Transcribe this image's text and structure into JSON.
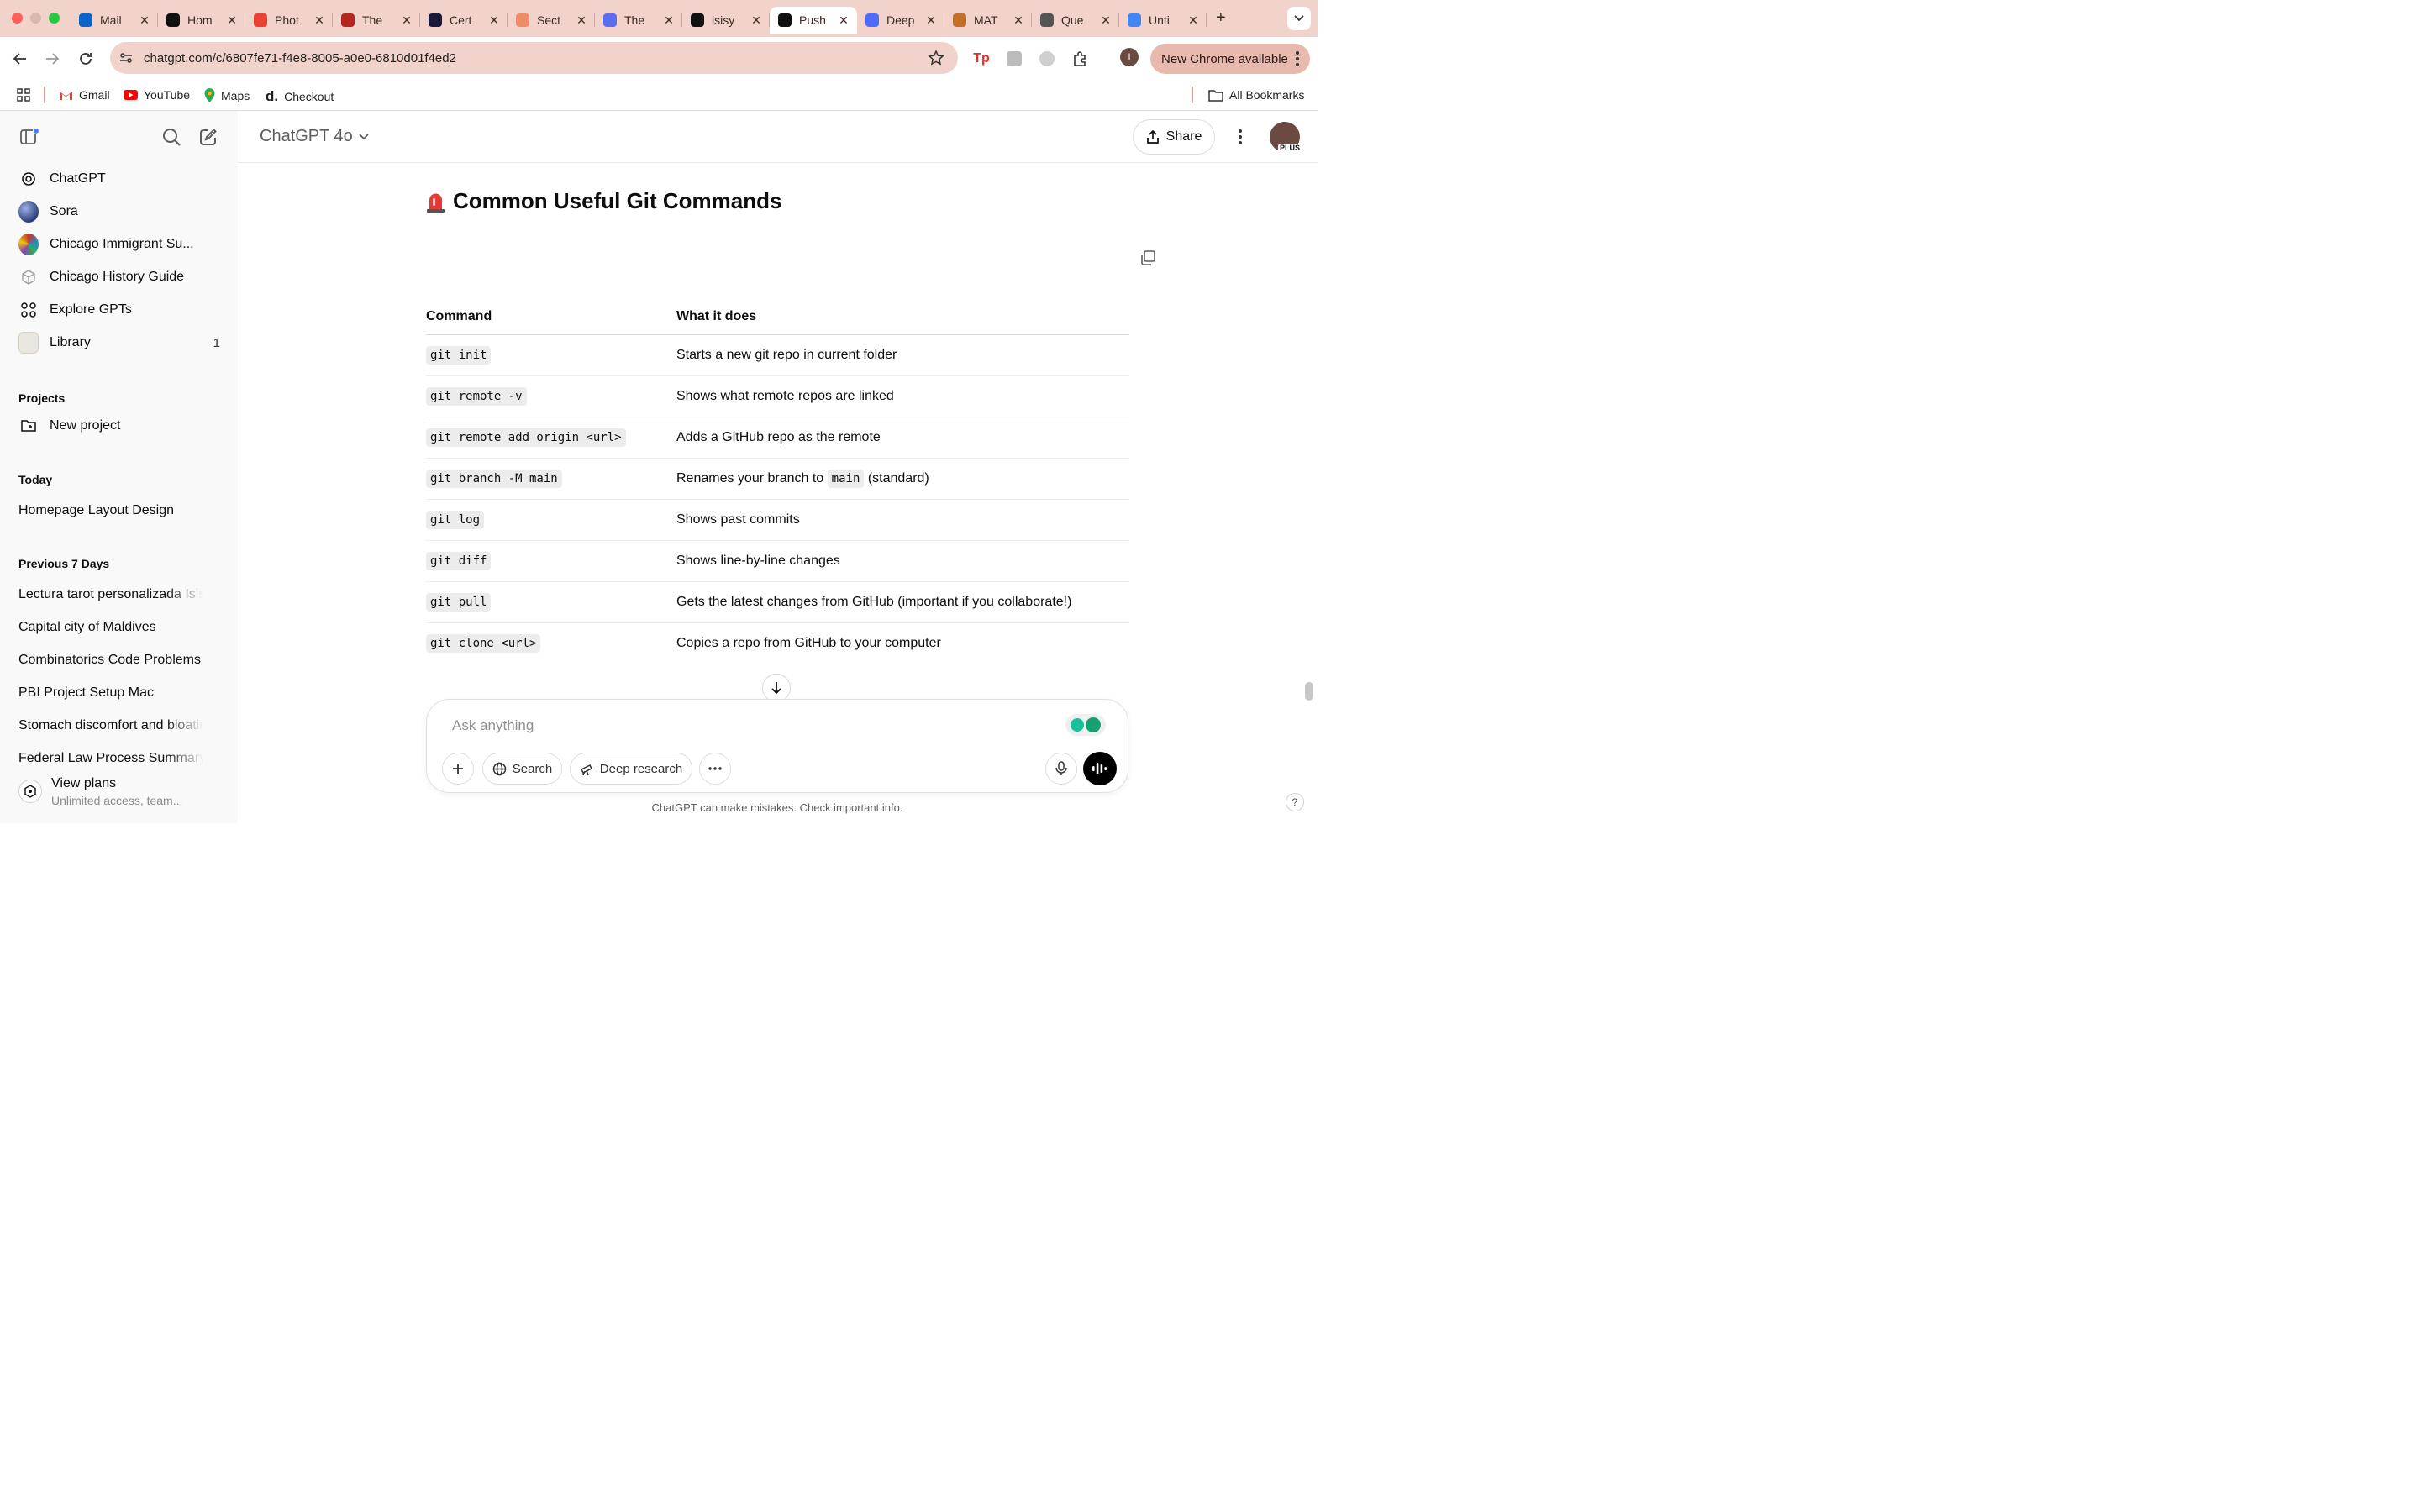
{
  "browser": {
    "tabs": [
      {
        "title": "Mail",
        "favicon": "outlook-icon",
        "color": "#0a64c8"
      },
      {
        "title": "Hom",
        "favicon": "openai-icon",
        "color": "#111111"
      },
      {
        "title": "Phot",
        "favicon": "google-photos-icon",
        "color": "#ea4335"
      },
      {
        "title": "The",
        "favicon": "book-icon",
        "color": "#b3261e"
      },
      {
        "title": "Cert",
        "favicon": "certificate-icon",
        "color": "#1a1a3a"
      },
      {
        "title": "Sect",
        "favicon": "zybooks-icon",
        "color": "#f08c6a"
      },
      {
        "title": "The",
        "favicon": "alarm-icon",
        "color": "#5b6cf0"
      },
      {
        "title": "isisy",
        "favicon": "github-icon",
        "color": "#111111"
      },
      {
        "title": "Push",
        "favicon": "openai-icon",
        "color": "#111111",
        "active": true
      },
      {
        "title": "Deep",
        "favicon": "deepseek-icon",
        "color": "#4d6bfe"
      },
      {
        "title": "MAT",
        "favicon": "graduation-icon",
        "color": "#c0702a"
      },
      {
        "title": "Que",
        "favicon": "globe-icon",
        "color": "#555555"
      },
      {
        "title": "Unti",
        "favicon": "docs-icon",
        "color": "#4285f4"
      }
    ],
    "url": "chatgpt.com/c/6807fe71-f4e8-8005-a0e0-6810d01f4ed2",
    "profile_initial": "I",
    "update_label": "New Chrome available",
    "bookmarks": [
      {
        "label": "Gmail",
        "icon": "gmail-icon"
      },
      {
        "label": "YouTube",
        "icon": "youtube-icon"
      },
      {
        "label": "Maps",
        "icon": "maps-icon"
      },
      {
        "label": "Checkout",
        "icon": "d-icon"
      }
    ],
    "all_bookmarks": "All Bookmarks"
  },
  "sidebar": {
    "nav": [
      {
        "label": "ChatGPT",
        "icon": "openai-icon"
      },
      {
        "label": "Sora",
        "icon": "sora-icon"
      },
      {
        "label": "Chicago Immigrant Su...",
        "icon": "gpt-avatar-icon"
      },
      {
        "label": "Chicago History Guide",
        "icon": "cube-icon"
      },
      {
        "label": "Explore GPTs",
        "icon": "grid-icon"
      },
      {
        "label": "Library",
        "icon": "library-thumb-icon",
        "badge": "1"
      }
    ],
    "projects_heading": "Projects",
    "new_project": "New project",
    "sections": [
      {
        "heading": "Today",
        "items": [
          "Homepage Layout Design"
        ]
      },
      {
        "heading": "Previous 7 Days",
        "items": [
          "Lectura tarot personalizada Isis",
          "Capital city of Maldives",
          "Combinatorics Code Problems",
          "PBI Project Setup Mac",
          "Stomach discomfort and bloating",
          "Federal Law Process Summary"
        ]
      }
    ],
    "view_plans": {
      "title": "View plans",
      "subtitle": "Unlimited access, team..."
    }
  },
  "header": {
    "model": "ChatGPT 4o",
    "share": "Share",
    "avatar_badge": "PLUS"
  },
  "message": {
    "heading": "Common Useful Git Commands",
    "heading_icon": "rotating-light-emoji",
    "table": {
      "columns": [
        "Command",
        "What it does"
      ],
      "rows": [
        {
          "command": "git init",
          "desc": "Starts a new git repo in current folder"
        },
        {
          "command": "git remote -v",
          "desc": "Shows what remote repos are linked"
        },
        {
          "command": "git remote add origin <url>",
          "desc": "Adds a GitHub repo as the remote"
        },
        {
          "command": "git branch -M main",
          "desc_before": "Renames your branch to ",
          "desc_code": "main",
          "desc_after": " (standard)"
        },
        {
          "command": "git log",
          "desc": "Shows past commits"
        },
        {
          "command": "git diff",
          "desc": "Shows line-by-line changes"
        },
        {
          "command": "git pull",
          "desc": "Gets the latest changes from GitHub (important if you collaborate!)"
        },
        {
          "command": "git clone <url>",
          "desc": "Copies a repo from GitHub to your computer"
        }
      ]
    }
  },
  "composer": {
    "placeholder": "Ask anything",
    "search": "Search",
    "deep_research": "Deep research"
  },
  "footer": {
    "disclaimer": "ChatGPT can make mistakes. Check important info.",
    "help": "?"
  }
}
